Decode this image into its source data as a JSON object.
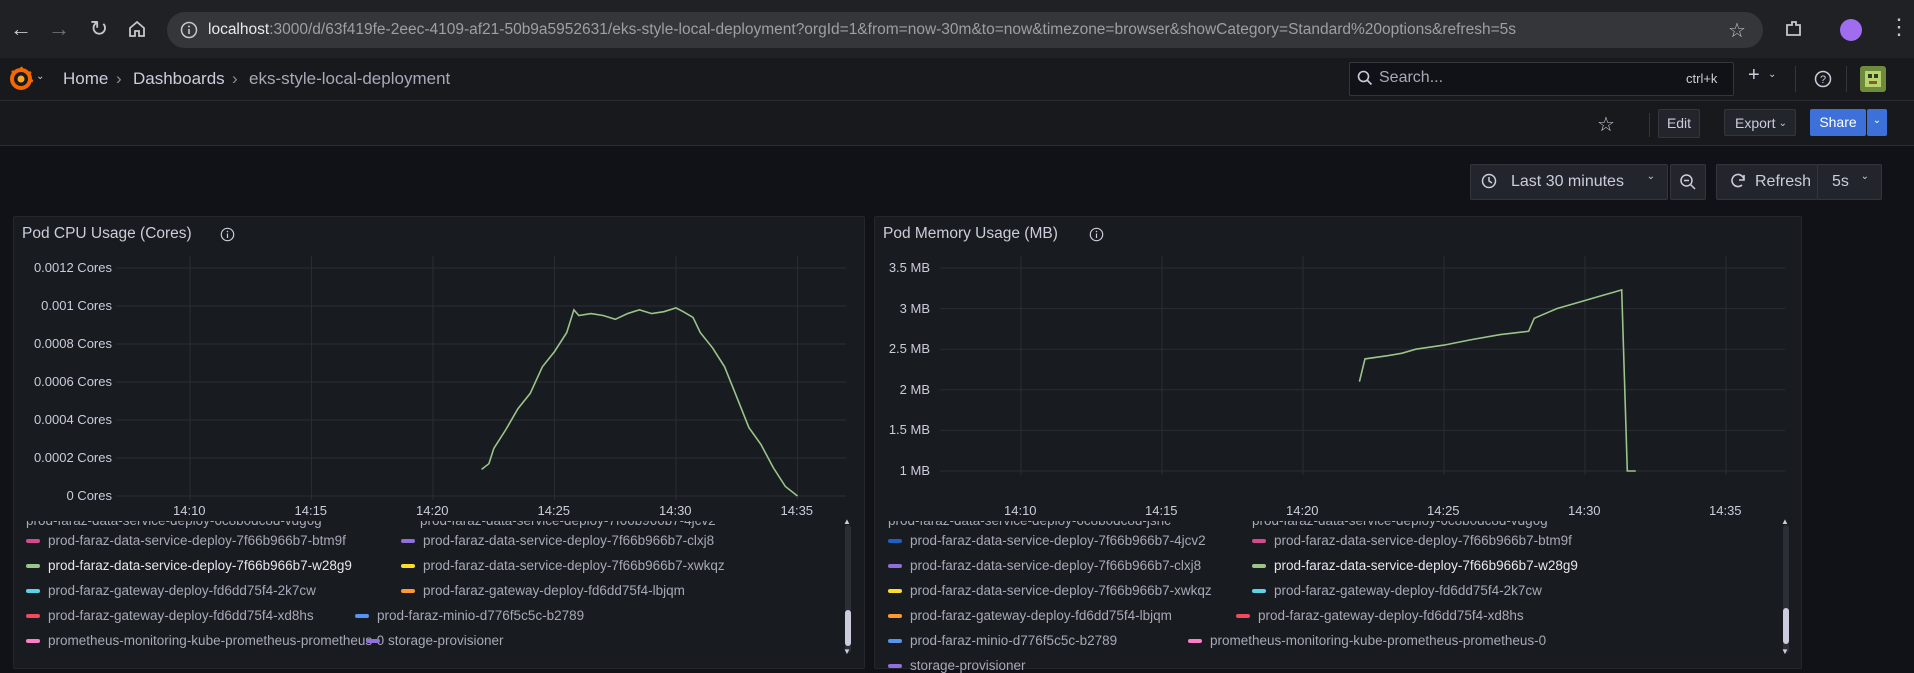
{
  "browser": {
    "url_host": "localhost",
    "url_rest": ":3000/d/63f419fe-2eec-4109-af21-50b9a5952631/eks-style-local-deployment?orgId=1&from=now-30m&to=now&timezone=browser&showCategory=Standard%20options&refresh=5s"
  },
  "nav": {
    "breadcrumbs": [
      "Home",
      "Dashboards",
      "eks-style-local-deployment"
    ],
    "search_placeholder": "Search...",
    "search_shortcut": "ctrl+k"
  },
  "toolbar": {
    "edit": "Edit",
    "export": "Export",
    "share": "Share",
    "time_range": "Last 30 minutes",
    "refresh": "Refresh",
    "refresh_interval": "5s"
  },
  "panels": {
    "cpu": {
      "title": "Pod CPU Usage (Cores)",
      "y_ticks": [
        "0.0012 Cores",
        "0.001 Cores",
        "0.0008 Cores",
        "0.0006 Cores",
        "0.0004 Cores",
        "0.0002 Cores",
        "0 Cores"
      ],
      "x_ticks": [
        "14:10",
        "14:15",
        "14:20",
        "14:25",
        "14:30",
        "14:35"
      ],
      "legend_partial": [
        "prod-faraz-data-service-deploy-6c8b0dc8d-vdg6g",
        "prod-faraz-data-service-deploy-7f66b966b7-4jcv2"
      ],
      "legend": [
        {
          "name": "prod-faraz-data-service-deploy-7f66b966b7-btm9f",
          "color": "#d44a8a"
        },
        {
          "name": "prod-faraz-data-service-deploy-7f66b966b7-clxj8",
          "color": "#8f6fd9"
        },
        {
          "name": "prod-faraz-data-service-deploy-7f66b966b7-w28g9",
          "color": "#9ac48a",
          "highlight": true
        },
        {
          "name": "prod-faraz-data-service-deploy-7f66b966b7-xwkqz",
          "color": "#fade2a"
        },
        {
          "name": "prod-faraz-gateway-deploy-fd6dd75f4-2k7cw",
          "color": "#5ad4e6"
        },
        {
          "name": "prod-faraz-gateway-deploy-fd6dd75f4-lbjqm",
          "color": "#ff9830"
        },
        {
          "name": "prod-faraz-gateway-deploy-fd6dd75f4-xd8hs",
          "color": "#f2495c"
        },
        {
          "name": "prod-faraz-minio-d776f5c5c-b2789",
          "color": "#5794f2"
        },
        {
          "name": "prometheus-monitoring-kube-prometheus-prometheus-0",
          "color": "#ff7ec7"
        },
        {
          "name": "storage-provisioner",
          "color": "#8f6fd9"
        }
      ]
    },
    "mem": {
      "title": "Pod Memory Usage (MB)",
      "y_ticks": [
        "3.5 MB",
        "3 MB",
        "2.5 MB",
        "2 MB",
        "1.5 MB",
        "1 MB"
      ],
      "x_ticks": [
        "14:10",
        "14:15",
        "14:20",
        "14:25",
        "14:30",
        "14:35"
      ],
      "legend_partial": [
        "prod-faraz-data-service-deploy-6c8b0dc8d-jsnc",
        "prod-faraz-data-service-deploy-6c8b0dc8d-vdg6g"
      ],
      "legend": [
        {
          "name": "prod-faraz-data-service-deploy-7f66b966b7-4jcv2",
          "color": "#1f60c4"
        },
        {
          "name": "prod-faraz-data-service-deploy-7f66b966b7-btm9f",
          "color": "#d44a8a"
        },
        {
          "name": "prod-faraz-data-service-deploy-7f66b966b7-clxj8",
          "color": "#8f6fd9"
        },
        {
          "name": "prod-faraz-data-service-deploy-7f66b966b7-w28g9",
          "color": "#9ac48a",
          "highlight": true
        },
        {
          "name": "prod-faraz-data-service-deploy-7f66b966b7-xwkqz",
          "color": "#fade2a"
        },
        {
          "name": "prod-faraz-gateway-deploy-fd6dd75f4-2k7cw",
          "color": "#5ad4e6"
        },
        {
          "name": "prod-faraz-gateway-deploy-fd6dd75f4-lbjqm",
          "color": "#ff9830"
        },
        {
          "name": "prod-faraz-gateway-deploy-fd6dd75f4-xd8hs",
          "color": "#f2495c"
        },
        {
          "name": "prod-faraz-minio-d776f5c5c-b2789",
          "color": "#5794f2"
        },
        {
          "name": "prometheus-monitoring-kube-prometheus-prometheus-0",
          "color": "#ff7ec7"
        },
        {
          "name": "storage-provisioner",
          "color": "#8f6fd9"
        }
      ]
    }
  },
  "chart_data": [
    {
      "type": "line",
      "title": "Pod CPU Usage (Cores)",
      "x_unit": "minutes",
      "ylim": [
        0,
        0.0012
      ],
      "series": [
        {
          "name": "prod-faraz-data-service-deploy-7f66b966b7-w28g9",
          "color": "#9ac48a",
          "points": [
            [
              "14:22",
              0.00014
            ],
            [
              "14:22.3",
              0.00017
            ],
            [
              "14:22.5",
              0.00025
            ],
            [
              "14:23",
              0.00035
            ],
            [
              "14:23.5",
              0.00046
            ],
            [
              "14:24",
              0.00054
            ],
            [
              "14:24.5",
              0.00068
            ],
            [
              "14:25",
              0.00076
            ],
            [
              "14:25.5",
              0.00086
            ],
            [
              "14:25.8",
              0.00098
            ],
            [
              "14:26",
              0.00095
            ],
            [
              "14:26.5",
              0.00096
            ],
            [
              "14:27",
              0.00095
            ],
            [
              "14:27.5",
              0.00093
            ],
            [
              "14:28",
              0.00096
            ],
            [
              "14:28.5",
              0.00098
            ],
            [
              "14:29",
              0.00096
            ],
            [
              "14:29.5",
              0.00097
            ],
            [
              "14:30",
              0.00099
            ],
            [
              "14:30.3",
              0.00097
            ],
            [
              "14:30.7",
              0.00094
            ],
            [
              "14:31",
              0.00086
            ],
            [
              "14:31.5",
              0.00078
            ],
            [
              "14:32",
              0.00068
            ],
            [
              "14:32.5",
              0.00052
            ],
            [
              "14:33",
              0.00036
            ],
            [
              "14:33.5",
              0.00027
            ],
            [
              "14:34",
              0.00015
            ],
            [
              "14:34.5",
              5e-05
            ],
            [
              "14:35",
              0.0
            ]
          ]
        }
      ]
    },
    {
      "type": "line",
      "title": "Pod Memory Usage (MB)",
      "x_unit": "minutes",
      "ylim": [
        0.9,
        3.6
      ],
      "series": [
        {
          "name": "prod-faraz-data-service-deploy-7f66b966b7-w28g9",
          "color": "#9ac48a",
          "points": [
            [
              "14:22",
              2.1
            ],
            [
              "14:22.2",
              2.38
            ],
            [
              "14:23",
              2.42
            ],
            [
              "14:23.5",
              2.45
            ],
            [
              "14:24",
              2.5
            ],
            [
              "14:25",
              2.55
            ],
            [
              "14:26",
              2.62
            ],
            [
              "14:27",
              2.68
            ],
            [
              "14:28",
              2.72
            ],
            [
              "14:28.2",
              2.88
            ],
            [
              "14:29",
              3.0
            ],
            [
              "14:30",
              3.1
            ],
            [
              "14:30.5",
              3.15
            ],
            [
              "14:31",
              3.2
            ],
            [
              "14:31.3",
              3.23
            ],
            [
              "14:31.5",
              1.0
            ],
            [
              "14:31.8",
              1.0
            ]
          ]
        }
      ]
    }
  ]
}
